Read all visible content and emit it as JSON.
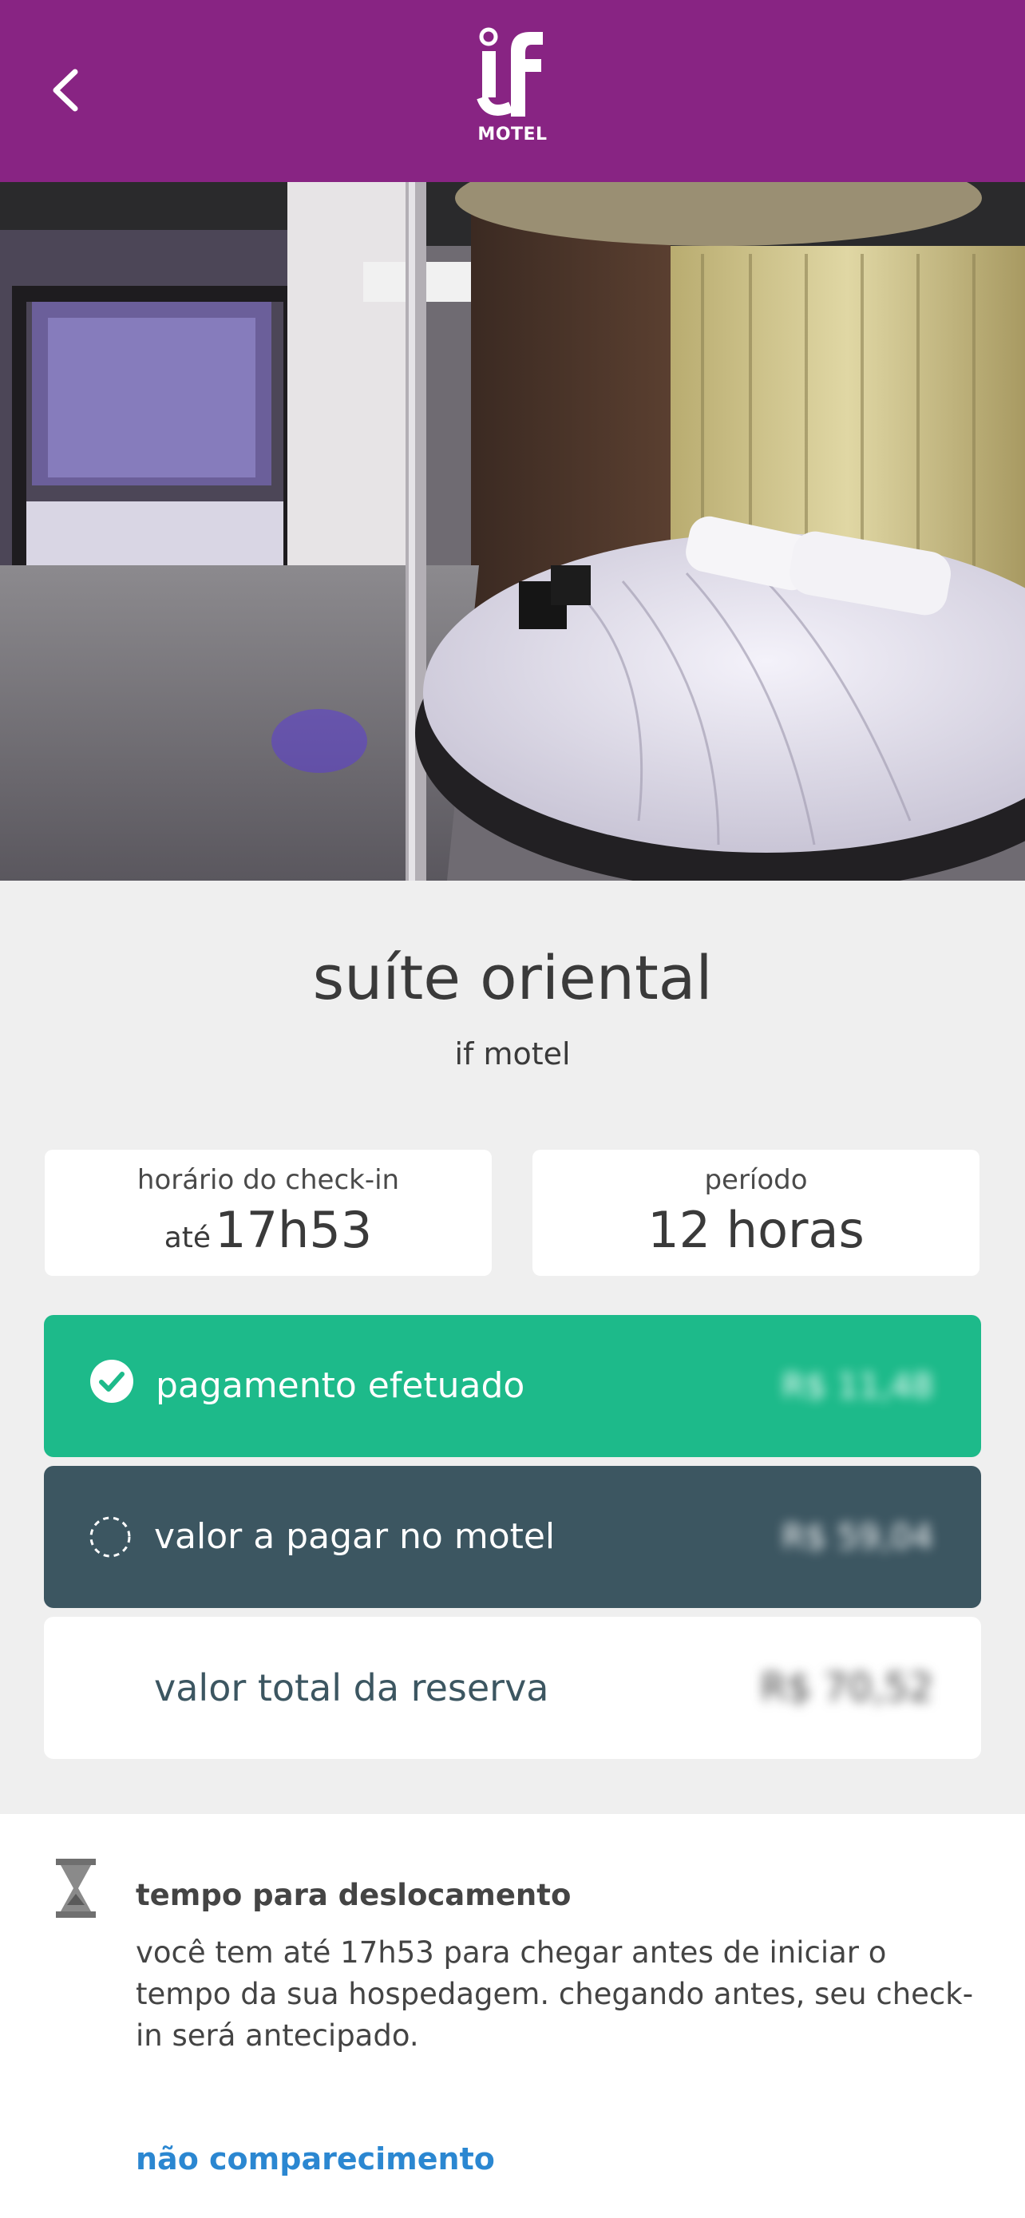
{
  "header": {
    "back_icon": "chevron-left-icon",
    "logo_text": "MOTEL",
    "logo_mark": "if"
  },
  "suite": {
    "name": "suíte oriental",
    "motel": "if motel"
  },
  "checkin": {
    "label": "horário do check-in",
    "prefix": "até",
    "time": "17h53"
  },
  "period": {
    "label": "período",
    "value": "12 horas"
  },
  "payments": [
    {
      "label": "pagamento efetuado",
      "amount": "R$ 11,48",
      "icon": "check-circle-icon",
      "color": "#1dba8a"
    },
    {
      "label": "valor a pagar no motel",
      "amount": "R$ 59,04",
      "icon": "dashed-circle-icon",
      "color": "#3c5661"
    },
    {
      "label": "valor total da reserva",
      "amount": "R$ 70,52",
      "color": "#ffffff"
    }
  ],
  "travel": {
    "icon": "hourglass-icon",
    "title": "tempo para deslocamento",
    "text": "você tem até 17h53 para chegar antes de iniciar o tempo da sua hospedagem. chegando antes, seu check-in será antecipado.",
    "link": "não comparecimento"
  }
}
